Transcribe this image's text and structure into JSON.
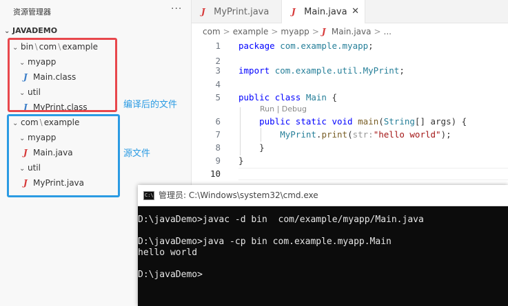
{
  "sidebar": {
    "title": "资源管理器",
    "more": "···",
    "root": "JAVADEMO",
    "bin_path": [
      "bin",
      "com",
      "example"
    ],
    "bin_myapp": "myapp",
    "bin_main": "Main.class",
    "bin_util": "util",
    "bin_myprint": "MyPrint.class",
    "src_path": [
      "com",
      "example"
    ],
    "src_myapp": "myapp",
    "src_main": "Main.java",
    "src_util": "util",
    "src_myprint": "MyPrint.java",
    "annotation_compiled": "编译后的文件",
    "annotation_source": "源文件",
    "java_icon_letter": "J"
  },
  "tabs": [
    {
      "label": "MyPrint.java"
    },
    {
      "label": "Main.java",
      "close": "✕"
    }
  ],
  "breadcrumb": [
    "com",
    "example",
    "myapp",
    "Main.java",
    "..."
  ],
  "code": {
    "line_numbers": [
      "1",
      "2",
      "3",
      "4",
      "5",
      "6",
      "7",
      "8",
      "9",
      "10"
    ],
    "codelens": "Run | Debug"
  },
  "cmd": {
    "title": "管理员: C:\\Windows\\system32\\cmd.exe",
    "icon_text": "C:\\",
    "output": "D:\\javaDemo>javac -d bin  com/example/myapp/Main.java\n\nD:\\javaDemo>java -cp bin com.example.myapp.Main\nhello world\n\nD:\\javaDemo>"
  },
  "colors": {
    "red_box": "#e8474c",
    "blue_box": "#2b9be3",
    "keyword": "#0000ff",
    "string": "#a31515"
  }
}
